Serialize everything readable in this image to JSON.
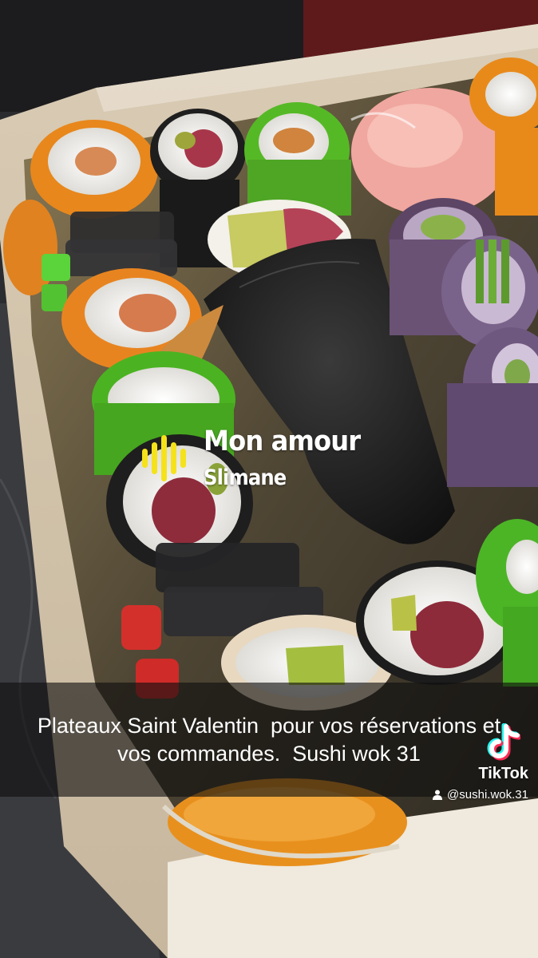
{
  "music": {
    "song": "Mon amour",
    "artist": "Slimane",
    "icon": "music-bars-icon",
    "accent": "#f5e21b"
  },
  "caption": {
    "text": "Plateaux Saint Valentin  pour vos réservations et vos commandes.  Sushi wok 31"
  },
  "tiktok": {
    "logo": "tiktok-logo-icon",
    "brand": "TikTok",
    "user_icon": "user-icon",
    "handle": "@sushi.wok.31"
  }
}
